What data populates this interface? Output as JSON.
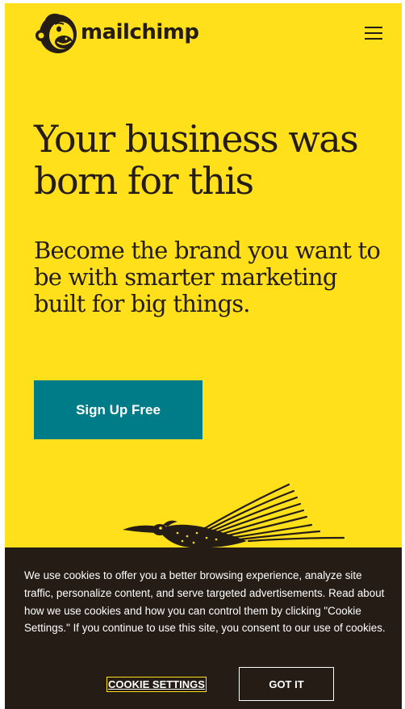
{
  "colors": {
    "brand_yellow": "#ffe01b",
    "ink": "#241c15",
    "cta_teal": "#007c89",
    "banner_bg": "#241c15",
    "white": "#ffffff"
  },
  "header": {
    "logo_icon": "freddie-chimp-logo-icon",
    "logo_text": "mailchimp",
    "menu_icon": "hamburger-menu-icon"
  },
  "hero": {
    "title": "Your business was born for this",
    "subtitle": "Become the brand you want to be with smarter marketing built for big things.",
    "cta_label": "Sign Up Free",
    "illustration_icon": "roadrunner-bird-illustration"
  },
  "cookie_banner": {
    "text": "We use cookies to offer you a better browsing experience, analyze site traffic, personalize content, and serve targeted advertisements. Read about how we use cookies and how you can control them by clicking \"Cookie Settings.\" If you continue to use this site, you consent to our use of cookies.",
    "settings_label": "COOKIE SETTINGS",
    "accept_label": "GOT IT"
  }
}
